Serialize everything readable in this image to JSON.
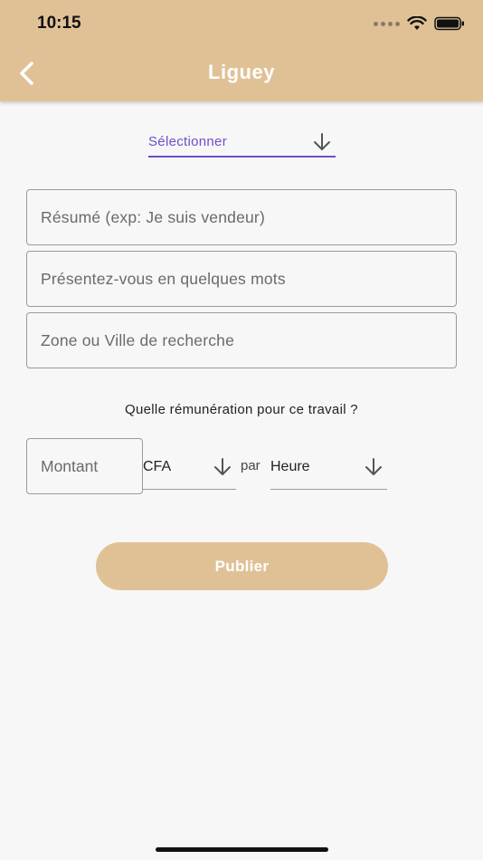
{
  "status_bar": {
    "time": "10:15"
  },
  "header": {
    "title": "Liguey",
    "back_icon": "chevron-left-icon"
  },
  "category_select": {
    "label": "Sélectionner",
    "accent": "#6e4fc8"
  },
  "fields": {
    "resume": "Résumé (exp: Je suis vendeur)",
    "presentation": "Présentez-vous en quelques mots",
    "zone": "Zone ou Ville de recherche"
  },
  "remuneration": {
    "question": "Quelle rémunération pour ce travail ?",
    "amount_placeholder": "Montant",
    "currency": "CFA",
    "per_label": "par",
    "period": "Heure"
  },
  "publish_button": "Publier",
  "colors": {
    "brand": "#e0c196",
    "background": "#f7f7f7"
  }
}
